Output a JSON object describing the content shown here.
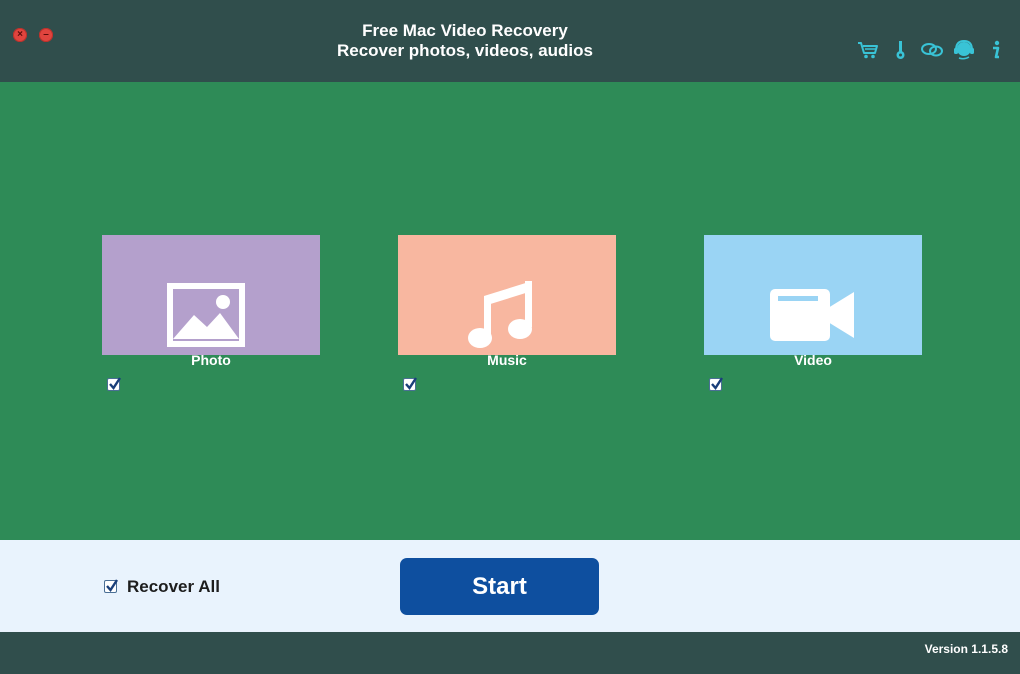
{
  "window": {
    "title_line1": "Free Mac Video Recovery",
    "title_line2": "Recover photos, videos, audios"
  },
  "toolbar_icons": [
    "cart-icon",
    "key-icon",
    "feedback-icon",
    "support-icon",
    "info-icon"
  ],
  "cards": [
    {
      "name": "photo",
      "label": "Photo",
      "checked": true,
      "color": "#b4a0cc",
      "icon": "image-icon"
    },
    {
      "name": "music",
      "label": "Music",
      "checked": true,
      "color": "#f8b7a0",
      "icon": "music-note-icon"
    },
    {
      "name": "video",
      "label": "Video",
      "checked": true,
      "color": "#9ad4f4",
      "icon": "video-camera-icon"
    }
  ],
  "bottom": {
    "recover_all_label": "Recover All",
    "recover_all_checked": true,
    "start_label": "Start"
  },
  "status": {
    "version": "Version 1.1.5.8"
  },
  "colors": {
    "titlebar": "#304e4c",
    "main_bg": "#2e8b57",
    "bottom_bg": "#e9f3fd",
    "start_button": "#0e4f9f",
    "toolbar_icon": "#39c3d6"
  }
}
